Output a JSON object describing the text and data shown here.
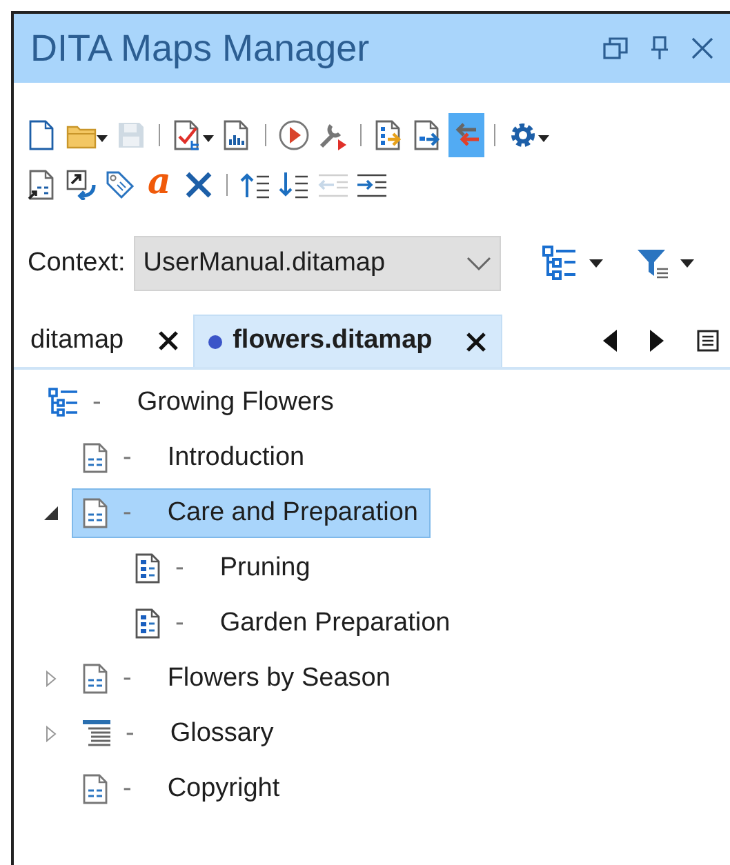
{
  "window": {
    "title": "DITA Maps Manager"
  },
  "toolbar": {
    "rows": [
      [
        {
          "kind": "button",
          "disabled": false,
          "pressed": false,
          "dropdown": false
        },
        {
          "kind": "button",
          "disabled": false,
          "pressed": false,
          "dropdown": true
        },
        {
          "kind": "button",
          "disabled": true,
          "pressed": false,
          "dropdown": false
        },
        {
          "kind": "separator"
        },
        {
          "kind": "button",
          "disabled": false,
          "pressed": false,
          "dropdown": true
        },
        {
          "kind": "button",
          "disabled": false,
          "pressed": false,
          "dropdown": false
        },
        {
          "kind": "separator"
        },
        {
          "kind": "button",
          "disabled": false,
          "pressed": false,
          "dropdown": false
        },
        {
          "kind": "button",
          "disabled": false,
          "pressed": false,
          "dropdown": false
        },
        {
          "kind": "separator"
        },
        {
          "kind": "button",
          "disabled": false,
          "pressed": false,
          "dropdown": false
        },
        {
          "kind": "button",
          "disabled": false,
          "pressed": false,
          "dropdown": false
        },
        {
          "kind": "button",
          "disabled": false,
          "pressed": true,
          "dropdown": false
        },
        {
          "kind": "separator"
        },
        {
          "kind": "button",
          "disabled": false,
          "pressed": false,
          "dropdown": true
        }
      ],
      [
        {
          "kind": "button",
          "disabled": false,
          "pressed": false,
          "dropdown": false
        },
        {
          "kind": "button",
          "disabled": false,
          "pressed": false,
          "dropdown": false
        },
        {
          "kind": "button",
          "disabled": false,
          "pressed": false,
          "dropdown": false
        },
        {
          "kind": "glyph",
          "text": "a"
        },
        {
          "kind": "button",
          "disabled": false,
          "pressed": false,
          "dropdown": false
        },
        {
          "kind": "separator"
        },
        {
          "kind": "button",
          "disabled": false,
          "pressed": false,
          "dropdown": false
        },
        {
          "kind": "button",
          "disabled": false,
          "pressed": false,
          "dropdown": false
        },
        {
          "kind": "button",
          "disabled": true,
          "pressed": false,
          "dropdown": false
        },
        {
          "kind": "button",
          "disabled": false,
          "pressed": false,
          "dropdown": false
        }
      ]
    ]
  },
  "context": {
    "label": "Context:",
    "value": "UserManual.ditamap"
  },
  "tabs": [
    {
      "label": "ditamap",
      "selected": false,
      "modified": false
    },
    {
      "label": "flowers.ditamap",
      "selected": true,
      "modified": true
    }
  ],
  "tree": [
    {
      "title": "Growing Flowers",
      "kind": "map",
      "dash": "-",
      "selected": false,
      "children": [
        {
          "title": "Introduction",
          "kind": "topic",
          "dash": "-",
          "selected": false
        },
        {
          "title": "Care and Preparation",
          "kind": "topic",
          "dash": "-",
          "selected": true,
          "expanded": true,
          "children": [
            {
              "title": "Pruning",
              "kind": "task",
              "dash": "-",
              "selected": false
            },
            {
              "title": "Garden Preparation",
              "kind": "task",
              "dash": "-",
              "selected": false
            }
          ]
        },
        {
          "title": "Flowers by Season",
          "kind": "topic",
          "dash": "-",
          "selected": false,
          "expanded": false
        },
        {
          "title": "Glossary",
          "kind": "glossary",
          "dash": "-",
          "selected": false,
          "expanded": false
        },
        {
          "title": "Copyright",
          "kind": "topic",
          "dash": "-",
          "selected": false
        }
      ]
    }
  ]
}
